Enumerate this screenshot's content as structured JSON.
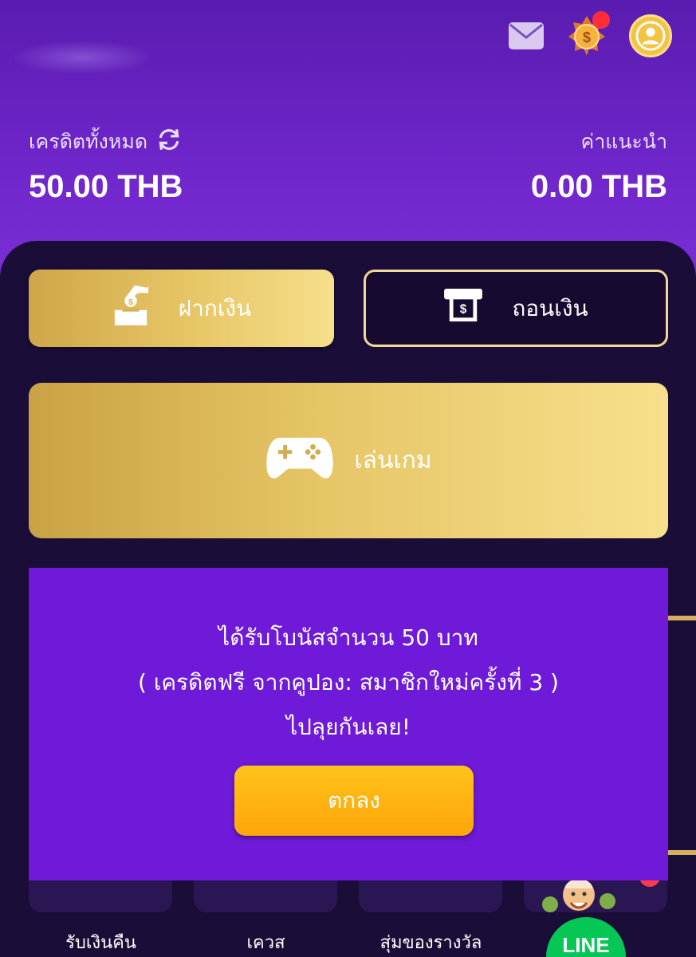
{
  "header": {
    "icons": [
      "mail-icon",
      "coin-badge-icon",
      "user-avatar-icon"
    ]
  },
  "balance": {
    "credit_label": "เครดิตทั้งหมด",
    "credit_amount": "50.00 THB",
    "referral_label": "ค่าแนะนำ",
    "referral_amount": "0.00 THB"
  },
  "actions": {
    "deposit_label": "ฝากเงิน",
    "withdraw_label": "ถอนเงิน",
    "play_label": "เล่นเกม"
  },
  "modal": {
    "line1": "ได้รับโบนัสจำนวน 50 บาท",
    "line2": "( เครดิตฟรี จากคูปอง: สมาชิกใหม่ครั้งที่ 3 )",
    "line3": "ไปลุยกันเลย!",
    "ok_label": "ตกลง"
  },
  "bottom_menu": {
    "items": [
      {
        "label": "รับเงินคืน"
      },
      {
        "label": "เควส"
      },
      {
        "label": "สุ่มของรางวัล"
      }
    ],
    "line_label": "LINE"
  },
  "colors": {
    "header_purple": "#6e25c9",
    "panel_dark": "#1a0d38",
    "gold": "#e6c566",
    "modal_purple": "#6e1ad8",
    "ok_orange": "#ffa60a",
    "line_green": "#06c755"
  }
}
